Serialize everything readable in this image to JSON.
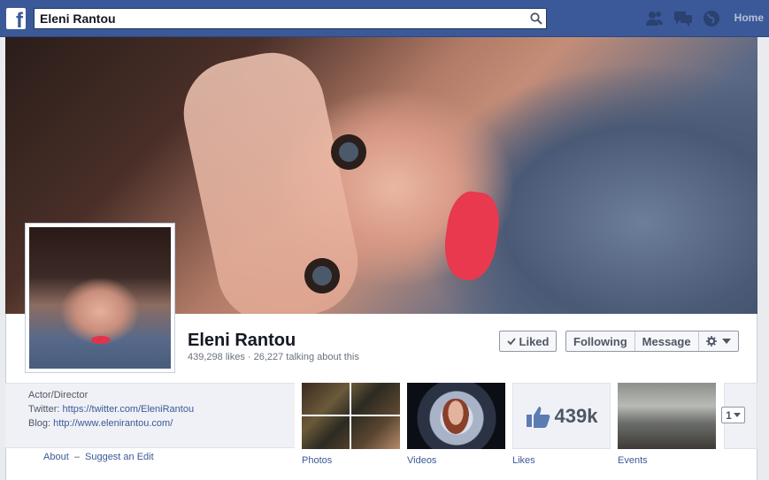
{
  "topbar": {
    "logo": "f",
    "search_value": "Eleni Rantou",
    "home_label": "Home"
  },
  "page": {
    "name": "Eleni Rantou",
    "stats": "439,298 likes · 26,227 talking about this"
  },
  "actions": {
    "liked_label": "Liked",
    "following_label": "Following",
    "message_label": "Message"
  },
  "about": {
    "category": "Actor/Director",
    "twitter_label": "Twitter:",
    "twitter_url": "https://twitter.com/EleniRantou",
    "blog_label": "Blog:",
    "blog_url": "http://www.elenirantou.com/",
    "about_link": "About",
    "separator": "–",
    "suggest_link": "Suggest an Edit"
  },
  "apps": {
    "photos_label": "Photos",
    "videos_label": "Videos",
    "likes_label": "Likes",
    "likes_count": "439k",
    "events_label": "Events",
    "pager_value": "1"
  },
  "colors": {
    "brand_blue": "#3b5998",
    "link_blue": "#3b5998",
    "lip_red": "#e8394f"
  },
  "icons": [
    "facebook-logo-icon",
    "search-icon",
    "friends-icon",
    "messages-icon",
    "notifications-globe-icon",
    "checkmark-icon",
    "gear-icon",
    "chevron-down-icon",
    "thumbs-up-icon"
  ]
}
